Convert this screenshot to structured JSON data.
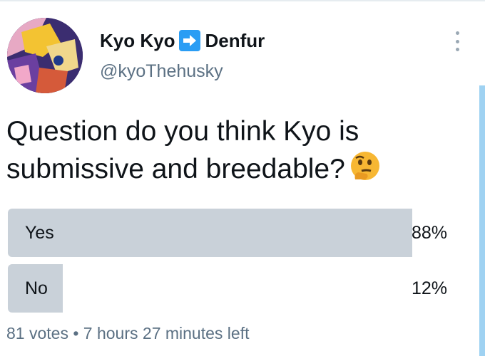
{
  "tweet": {
    "author": {
      "name_part1": "Kyo Kyo",
      "name_part2": "Denfur",
      "handle": "@kyoThehusky"
    },
    "question": "Question do you think Kyo is submissive and breedable?"
  },
  "poll": {
    "options": [
      {
        "label": "Yes",
        "percent_text": "88%",
        "percent": 88
      },
      {
        "label": "No",
        "percent_text": "12%",
        "percent": 12
      }
    ],
    "votes": "81 votes",
    "separator": "•",
    "time_left": "7 hours 27 minutes left"
  },
  "colors": {
    "accent": "#2a9df4",
    "bar": "#c9d1d9",
    "secondary_text": "#5b7083"
  },
  "icons": {
    "menu": "more-vertical-icon",
    "arrow": "right-arrow-emoji-icon",
    "emoji": "thinking-face-emoji-icon"
  }
}
